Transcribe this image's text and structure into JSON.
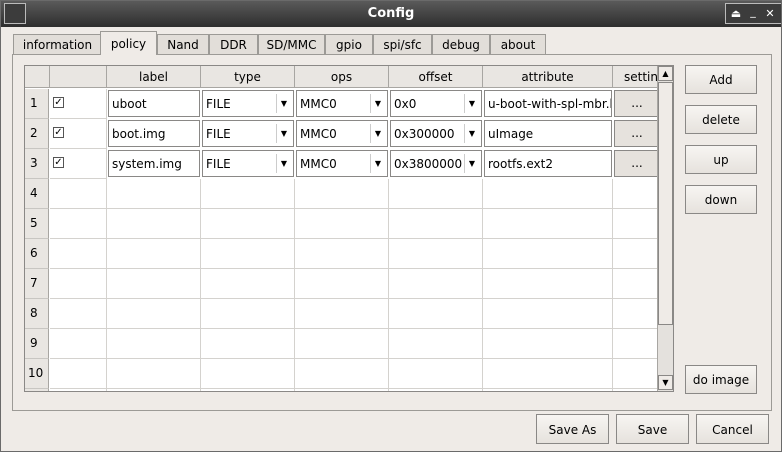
{
  "window": {
    "title": "Config"
  },
  "tabs": [
    "information",
    "policy",
    "Nand",
    "DDR",
    "SD/MMC",
    "gpio",
    "spi/sfc",
    "debug",
    "about"
  ],
  "active_tab": "policy",
  "table": {
    "columns": [
      "label",
      "type",
      "ops",
      "offset",
      "attribute",
      "setting"
    ],
    "row_numbers": [
      "1",
      "2",
      "3",
      "4",
      "5",
      "6",
      "7",
      "8",
      "9",
      "10"
    ],
    "rows": [
      {
        "checked": true,
        "label": "uboot",
        "type": "FILE",
        "ops": "MMC0",
        "offset": "0x0",
        "attribute": "u-boot-with-spl-mbr.bin",
        "setting": "..."
      },
      {
        "checked": true,
        "label": "boot.img",
        "type": "FILE",
        "ops": "MMC0",
        "offset": "0x300000",
        "attribute": "uImage",
        "setting": "..."
      },
      {
        "checked": true,
        "label": "system.img",
        "type": "FILE",
        "ops": "MMC0",
        "offset": "0x3800000",
        "attribute": "rootfs.ext2",
        "setting": "..."
      }
    ]
  },
  "side_buttons": {
    "add": "Add",
    "delete": "delete",
    "up": "up",
    "down": "down",
    "do_image": "do image"
  },
  "bottom_buttons": {
    "save_as": "Save As",
    "save": "Save",
    "cancel": "Cancel"
  },
  "icons": {
    "window_controls": [
      "shade-icon",
      "minimize-icon",
      "close-icon"
    ]
  }
}
